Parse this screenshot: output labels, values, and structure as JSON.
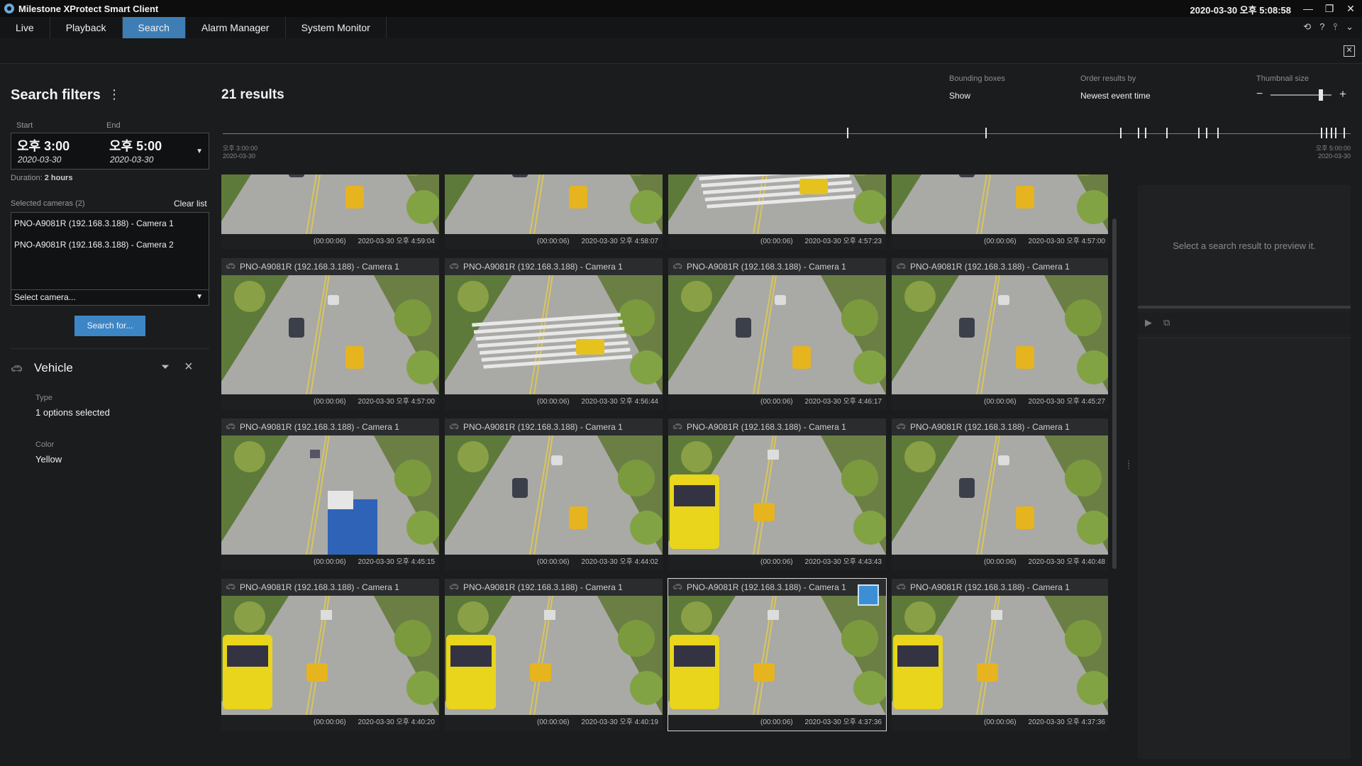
{
  "window": {
    "title": "Milestone XProtect Smart Client",
    "clock": "2020-03-30 오후 5:08:58",
    "buttons": {
      "minimize": "—",
      "restore": "❐",
      "close": "✕"
    }
  },
  "tabs": [
    {
      "label": "Live"
    },
    {
      "label": "Playback"
    },
    {
      "label": "Search",
      "active": true
    },
    {
      "label": "Alarm Manager"
    },
    {
      "label": "System Monitor"
    }
  ],
  "filters": {
    "title": "Search filters",
    "menu": "⋮",
    "start_label": "Start",
    "end_label": "End",
    "start_time": "오후 3:00",
    "start_date": "2020-03-30",
    "end_time": "오후 5:00",
    "end_date": "2020-03-30",
    "duration_label": "Duration:",
    "duration_value": "2 hours",
    "selected_cameras_label": "Selected cameras (2)",
    "clear_list": "Clear list",
    "cameras": [
      "PNO-A9081R (192.168.3.188) - Camera 1",
      "PNO-A9081R (192.168.3.188) - Camera 2"
    ],
    "select_camera": "Select camera...",
    "search_button": "Search for...",
    "vehicle": {
      "title": "Vehicle",
      "type_label": "Type",
      "type_value": "1 options selected",
      "color_label": "Color",
      "color_value": "Yellow"
    }
  },
  "results": {
    "count_text": "21 results",
    "bounding_label": "Bounding boxes",
    "bounding_value": "Show",
    "order_label": "Order results by",
    "order_value": "Newest event time",
    "thumb_label": "Thumbnail size",
    "thumb_level": 0.82
  },
  "timeline": {
    "start_time": "오후 3:00:00",
    "start_date": "2020-03-30",
    "end_time": "오후 5:00:00",
    "end_date": "2020-03-30"
  },
  "cards": [
    {
      "camera": "",
      "duration": "(00:00:06)",
      "timestamp": "2020-03-30 오후 4:59:04",
      "scene": "road",
      "partial": true
    },
    {
      "camera": "",
      "duration": "(00:00:06)",
      "timestamp": "2020-03-30 오후 4:58:07",
      "scene": "road",
      "partial": true
    },
    {
      "camera": "",
      "duration": "(00:00:06)",
      "timestamp": "2020-03-30 오후 4:57:23",
      "scene": "crosswalk",
      "partial": true
    },
    {
      "camera": "",
      "duration": "(00:00:06)",
      "timestamp": "2020-03-30 오후 4:57:00",
      "scene": "road",
      "partial": true
    },
    {
      "camera": "PNO-A9081R (192.168.3.188) - Camera 1",
      "duration": "(00:00:06)",
      "timestamp": "2020-03-30 오후 4:57:00",
      "scene": "road"
    },
    {
      "camera": "PNO-A9081R (192.168.3.188) - Camera 1",
      "duration": "(00:00:06)",
      "timestamp": "2020-03-30 오후 4:56:44",
      "scene": "crosswalk"
    },
    {
      "camera": "PNO-A9081R (192.168.3.188) - Camera 1",
      "duration": "(00:00:06)",
      "timestamp": "2020-03-30 오후 4:46:17",
      "scene": "road"
    },
    {
      "camera": "PNO-A9081R (192.168.3.188) - Camera 1",
      "duration": "(00:00:06)",
      "timestamp": "2020-03-30 오후 4:45:27",
      "scene": "road"
    },
    {
      "camera": "PNO-A9081R (192.168.3.188) - Camera 1",
      "duration": "(00:00:06)",
      "timestamp": "2020-03-30 오후 4:45:15",
      "scene": "truck"
    },
    {
      "camera": "PNO-A9081R (192.168.3.188) - Camera 1",
      "duration": "(00:00:06)",
      "timestamp": "2020-03-30 오후 4:44:02",
      "scene": "road"
    },
    {
      "camera": "PNO-A9081R (192.168.3.188) - Camera 1",
      "duration": "(00:00:06)",
      "timestamp": "2020-03-30 오후 4:43:43",
      "scene": "bus"
    },
    {
      "camera": "PNO-A9081R (192.168.3.188) - Camera 1",
      "duration": "(00:00:06)",
      "timestamp": "2020-03-30 오후 4:40:48",
      "scene": "road"
    },
    {
      "camera": "PNO-A9081R (192.168.3.188) - Camera 1",
      "duration": "(00:00:06)",
      "timestamp": "2020-03-30 오후 4:40:20",
      "scene": "bus"
    },
    {
      "camera": "PNO-A9081R (192.168.3.188) - Camera 1",
      "duration": "(00:00:06)",
      "timestamp": "2020-03-30 오후 4:40:19",
      "scene": "bus"
    },
    {
      "camera": "PNO-A9081R (192.168.3.188) - Camera 1",
      "duration": "(00:00:06)",
      "timestamp": "2020-03-30 오후 4:37:36",
      "scene": "bus",
      "selected": true
    },
    {
      "camera": "PNO-A9081R (192.168.3.188) - Camera 1",
      "duration": "(00:00:06)",
      "timestamp": "2020-03-30 오후 4:37:36",
      "scene": "bus"
    }
  ],
  "preview": {
    "message": "Select a search result to preview it.",
    "play_icon": "▶",
    "snapshot_icon": "⧉"
  },
  "colors": {
    "accent": "#3e7eb5",
    "button": "#3d86c6",
    "background": "#1b1c1d"
  }
}
